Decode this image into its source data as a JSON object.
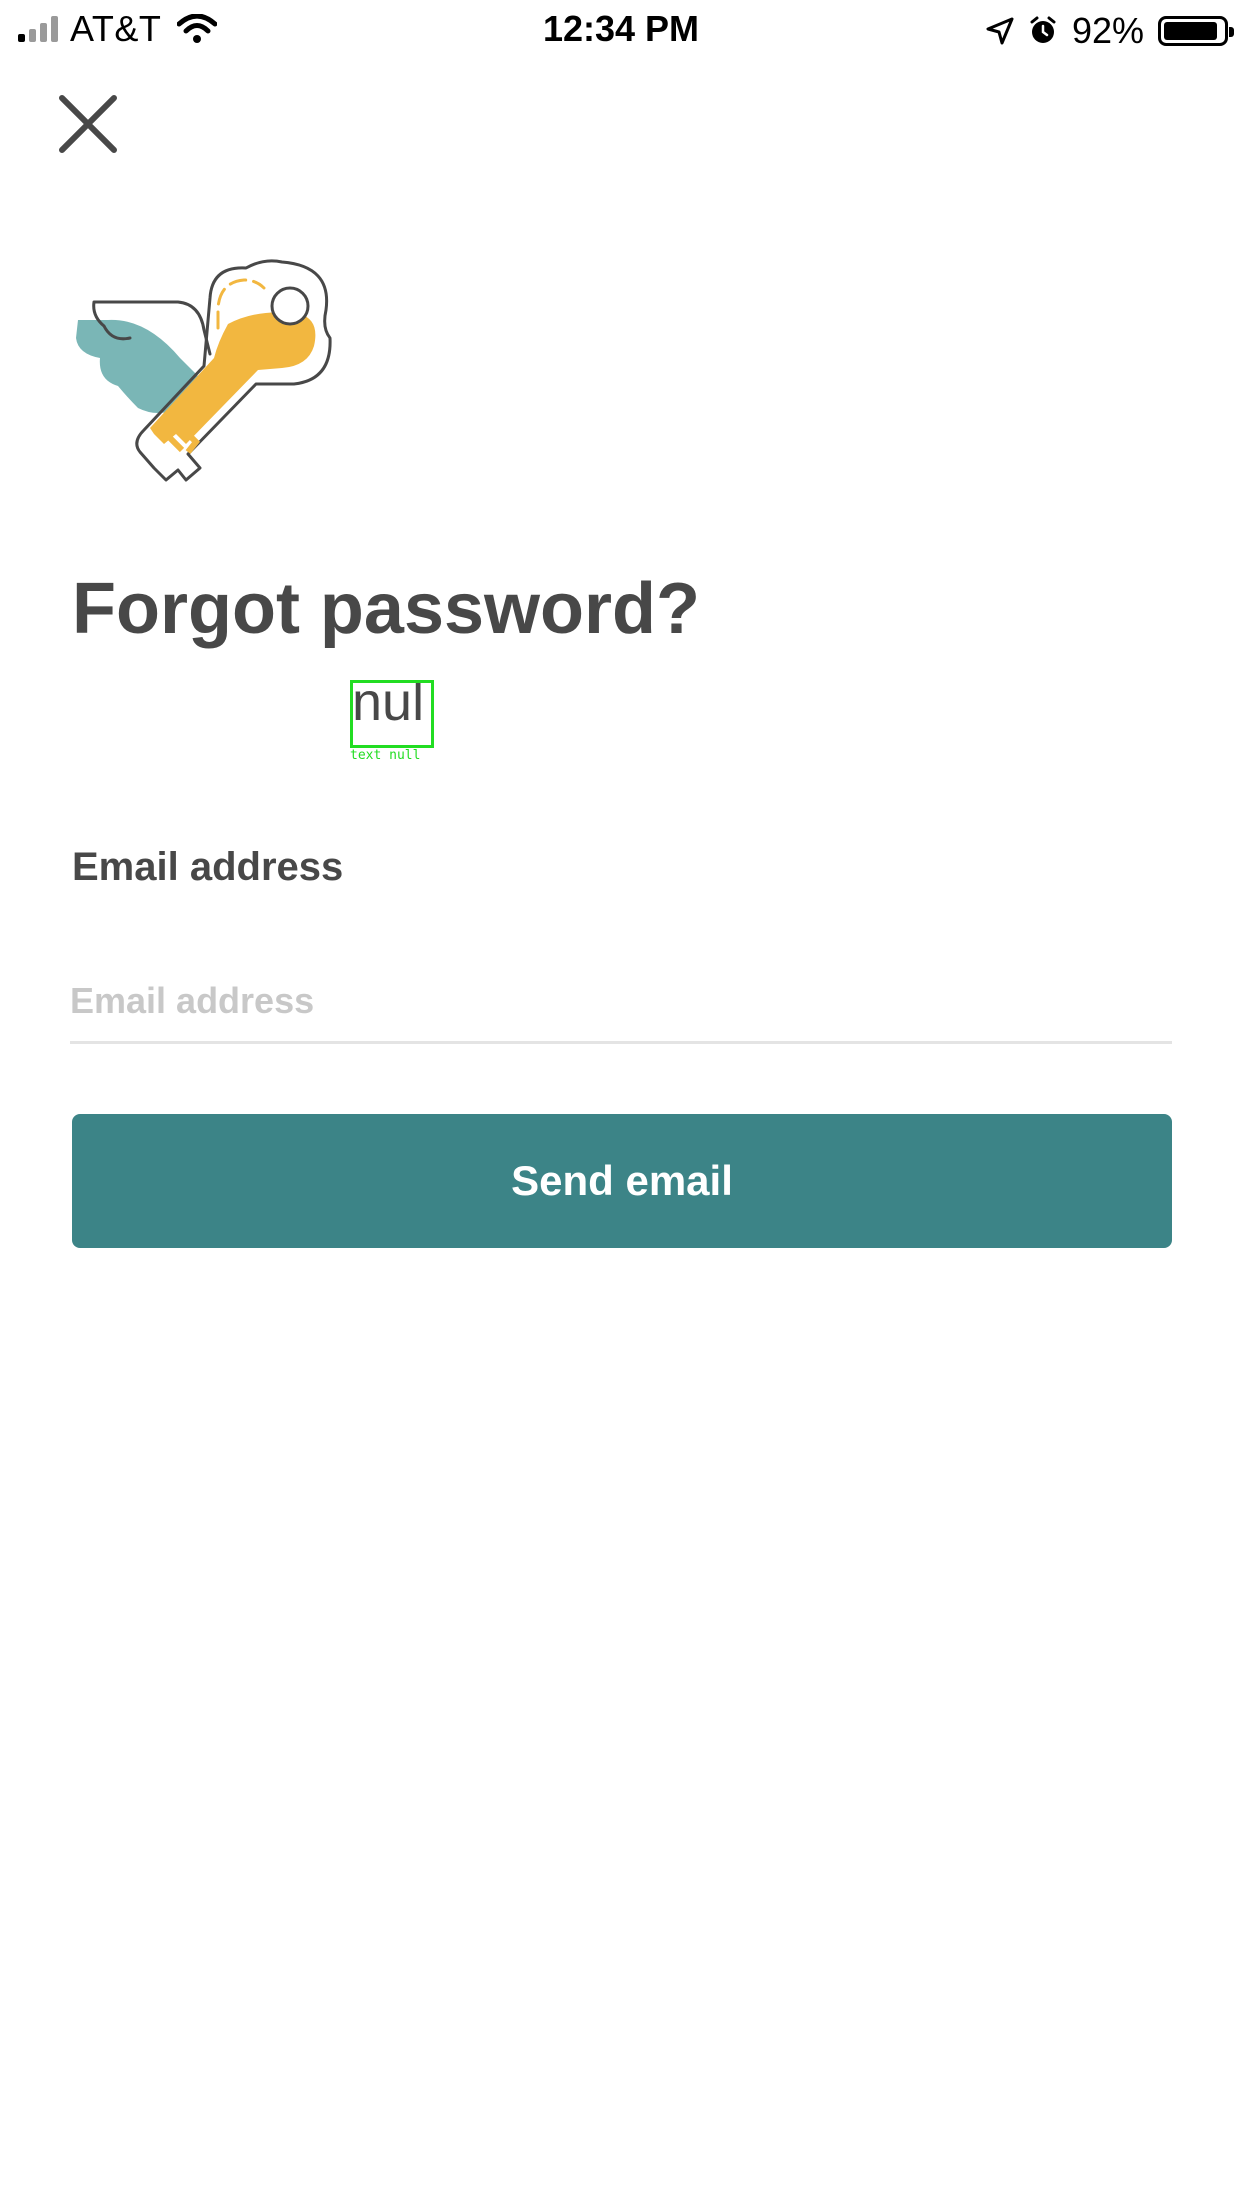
{
  "status_bar": {
    "carrier": "AT&T",
    "time": "12:34 PM",
    "battery_percent": "92%",
    "battery_level": 0.92,
    "signal_icon": "signal-bars-icon",
    "wifi_icon": "wifi-icon",
    "location_icon": "location-arrow-icon",
    "alarm_icon": "alarm-clock-icon"
  },
  "header": {
    "close_icon": "close-icon"
  },
  "illustration": {
    "icon": "winged-key-icon",
    "colors": {
      "wing": "#7ab6b6",
      "key": "#f2b740",
      "outline": "#484848"
    }
  },
  "main": {
    "title": "Forgot password?",
    "subtitle": "nul",
    "debug_label": "text null",
    "email_label": "Email address",
    "email_placeholder": "Email address",
    "email_value": "",
    "send_button_label": "Send email"
  },
  "colors": {
    "primary": "#3c8487",
    "text": "#484848",
    "placeholder": "#c8c8c8",
    "debug_outline": "#22dd22"
  }
}
